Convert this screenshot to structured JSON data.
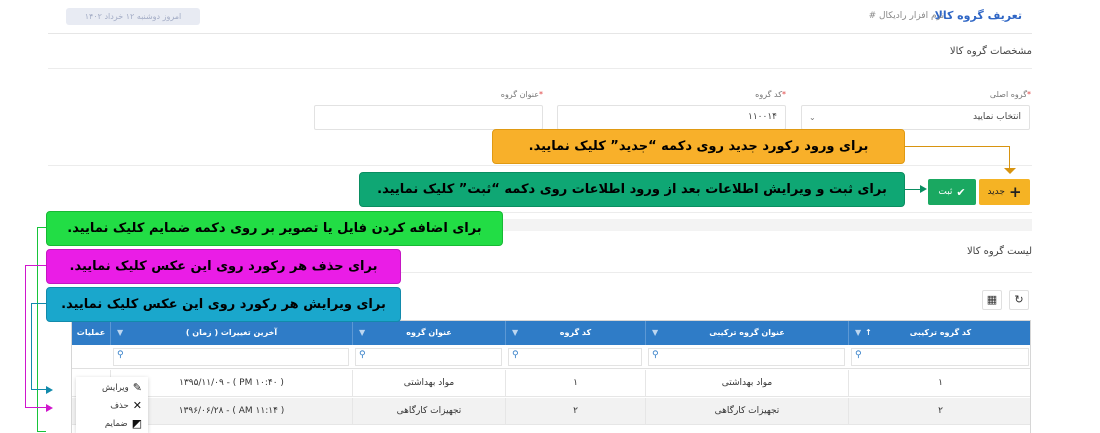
{
  "header": {
    "title": "تعریف گروه کالا",
    "breadcrumb": "# نرم افزار رادیکال",
    "date_text": "امروز دوشنبه ۱۲ خرداد ۱۴۰۲"
  },
  "form": {
    "section_title": "مشخصات گروه کالا",
    "main_group": {
      "label": "گروه اصلی",
      "value": "انتخاب نمایید"
    },
    "group_code": {
      "label": "کد گروه",
      "value": "۱۱۰۰۱۴"
    },
    "group_title": {
      "label": "عنوان گروه",
      "value": ""
    },
    "required_mark": "*"
  },
  "buttons": {
    "new_label": "جدید",
    "new_icon": "plus-icon",
    "save_label": "ثبت",
    "save_icon": "check-icon"
  },
  "callouts": {
    "new": "برای ورود رکورد جدید روی دکمه “جدید” کلیک نمایید.",
    "save": "برای ثبت و ویرایش اطلاعات بعد از ورود اطلاعات روی دکمه “ثبت” کلیک نمایید.",
    "attach": "برای اضافه کردن فایل یا تصویر بر روی دکمه ضمایم کلیک نمایید.",
    "delete": "برای حذف هر رکورد روی این عکس کلیک نمایید.",
    "edit": "برای ویرایش هر رکورد روی این عکس کلیک نمایید."
  },
  "list": {
    "section_title": "لیست گروه کالا",
    "tools": {
      "columns_icon": "columns-icon",
      "refresh_icon": "refresh-icon"
    },
    "columns": [
      "کد گروه ترکیبی",
      "عنوان گروه ترکیبی",
      "کد گروه",
      "عنوان گروه",
      "آخرین تغییرات ( زمان )",
      "عملیات"
    ],
    "rows": [
      {
        "combo_code": "۱",
        "combo_title": "مواد بهداشتی",
        "code": "۱",
        "title": "مواد بهداشتی",
        "changed": "۱۳۹۵/۱۱/۰۹ - ( PM ۱۰:۴۰ )"
      },
      {
        "combo_code": "۲",
        "combo_title": "تجهیزات کارگاهی",
        "code": "۲",
        "title": "تجهیزات کارگاهی",
        "changed": "۱۳۹۶/۰۶/۲۸ - ( AM ۱۱:۱۴ )"
      }
    ],
    "operations": {
      "edit": "ویرایش",
      "delete": "حذف",
      "attach": "ضمایم"
    }
  },
  "colors": {
    "header_blue": "#2f7cc7",
    "new_button": "#f5b324",
    "save_button": "#1aa861",
    "callout_orange": "#f8b02a",
    "callout_teal": "#0fa774",
    "callout_green": "#22dd45",
    "callout_magenta": "#ea1de6",
    "callout_blue": "#1aa7cc"
  }
}
